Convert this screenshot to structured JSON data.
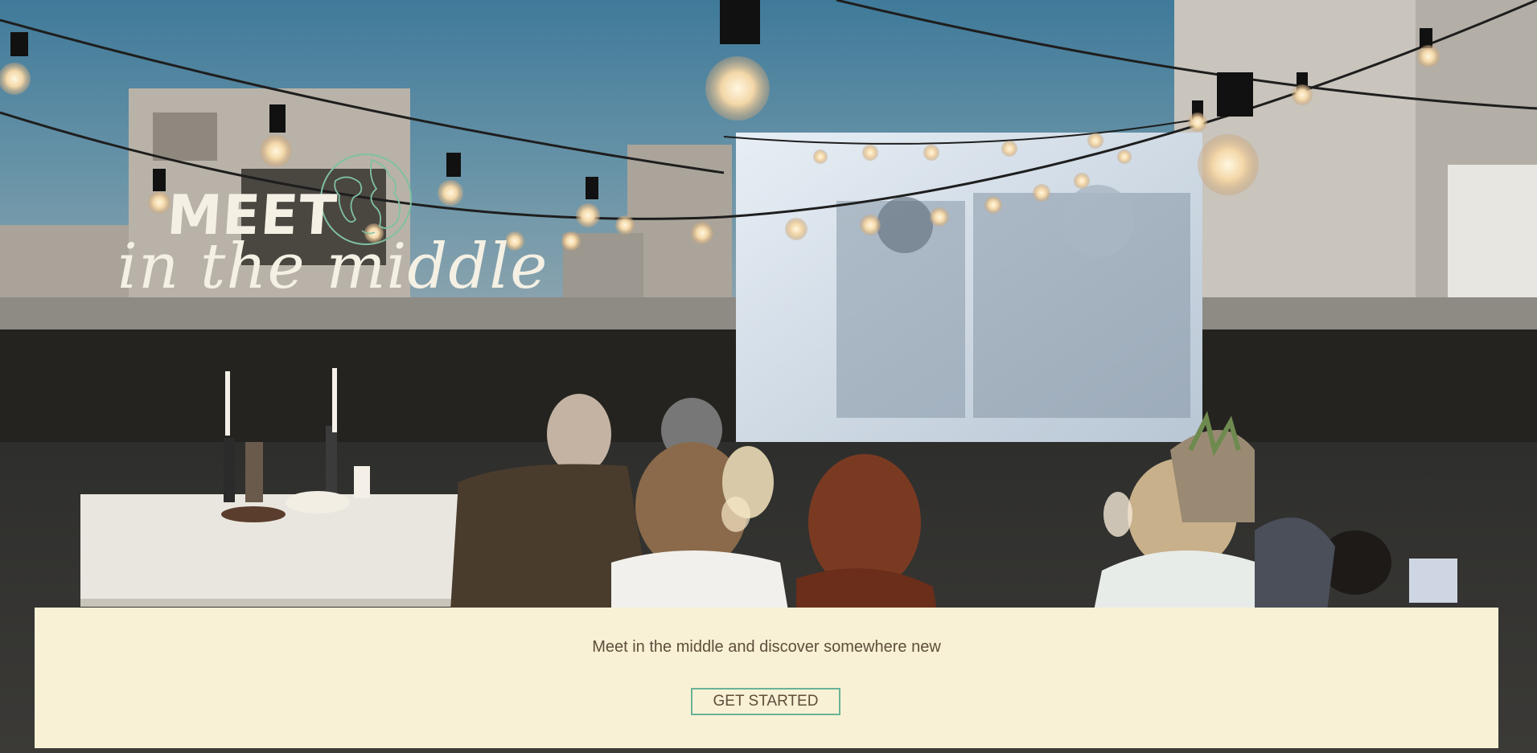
{
  "brand": {
    "logo_word": "MEET",
    "logo_script": "in the middle"
  },
  "hero": {
    "subtitle": "Meet in the middle and discover somewhere new",
    "cta_label": "GET STARTED"
  },
  "colors": {
    "panel_background": "#f8f1d5",
    "text": "#5e4e3c",
    "accent": "#6ab398",
    "logo_text": "#f4f0e4"
  },
  "icons": {
    "logo_globe": "globe-icon"
  }
}
